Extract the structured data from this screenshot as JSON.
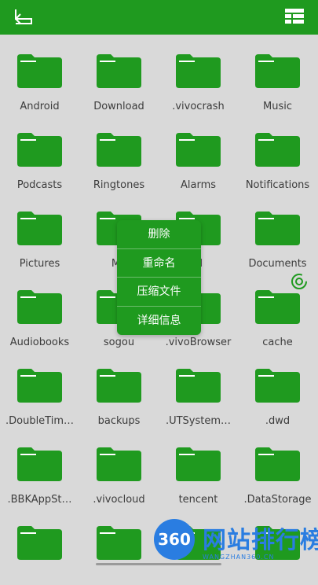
{
  "toolbar": {
    "back_icon": "back-arrow-icon",
    "view_icon": "grid-view-icon"
  },
  "folders": [
    "Android",
    "Download",
    ".vivocrash",
    "Music",
    "Podcasts",
    "Ringtones",
    "Alarms",
    "Notifications",
    "Pictures",
    "Mo",
    "M",
    "Documents",
    "Audiobooks",
    "sogou",
    ".vivoBrowser",
    "cache",
    ".DoubleTim…",
    "backups",
    ".UTSystem…",
    ".dwd",
    ".BBKAppSt…",
    ".vivocloud",
    "tencent",
    ".DataStorage",
    "",
    "",
    "",
    ""
  ],
  "context_menu": {
    "items": [
      "删除",
      "重命名",
      "压缩文件",
      "详细信息"
    ]
  },
  "watermark": {
    "badge": "360",
    "title": "网站排行榜",
    "sub": "WANGZHAN360.CN"
  },
  "colors": {
    "accent": "#1f9a1f",
    "background": "#d9d9d9"
  }
}
